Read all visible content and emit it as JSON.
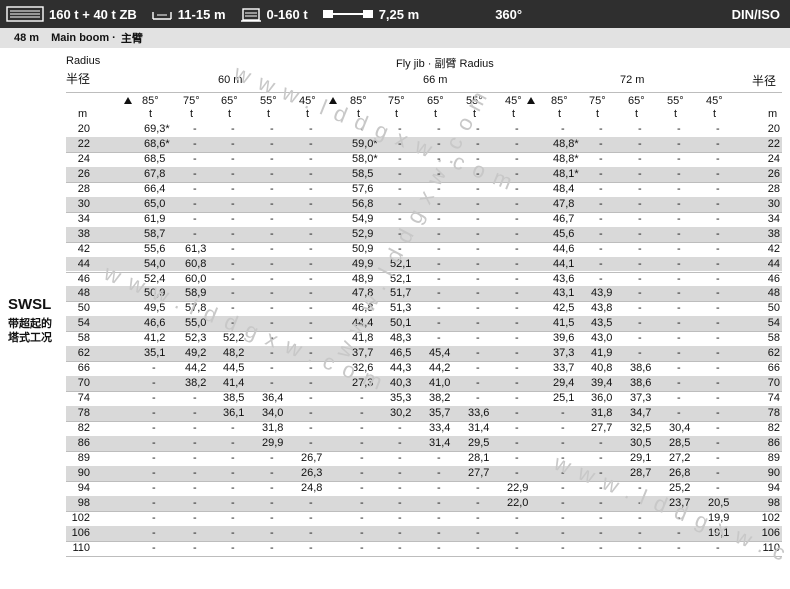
{
  "topbar": {
    "counterweight": "160 t + 40 t ZB",
    "support": "11-15 m",
    "ballast": "0-160 t",
    "track": "7,25 m",
    "slew": "360°",
    "standard": "DIN/ISO"
  },
  "subbar": {
    "boom": "48 m",
    "boom_label": "Main boom ·",
    "boom_label_cn": "主臂"
  },
  "header": {
    "radius_label": "Radius",
    "radius_label_cn": "半径",
    "jib_label": "Fly jib · 副臂 Radius",
    "radius_right_cn": "半径",
    "unit_m": "m",
    "unit_t": "t"
  },
  "side_label": {
    "code": "SWSL",
    "cn_line1": "带超起的",
    "cn_line2": "塔式工况"
  },
  "watermark": "www.lddgxw.com",
  "groups": [
    {
      "jib": "60 m",
      "angles": [
        "85°",
        "75°",
        "65°",
        "55°",
        "45°"
      ]
    },
    {
      "jib": "66 m",
      "angles": [
        "85°",
        "75°",
        "65°",
        "55°",
        "45°"
      ]
    },
    {
      "jib": "72 m",
      "angles": [
        "85°",
        "75°",
        "65°",
        "55°",
        "45°"
      ]
    }
  ],
  "radii": [
    "20",
    "22",
    "24",
    "26",
    "28",
    "30",
    "34",
    "38",
    "42",
    "44",
    "46",
    "48",
    "50",
    "54",
    "58",
    "62",
    "66",
    "70",
    "74",
    "78",
    "82",
    "86",
    "89",
    "90",
    "94",
    "98",
    "102",
    "106",
    "110"
  ],
  "rows": [
    [
      "69,3*",
      "-",
      "-",
      "-",
      "-",
      "-",
      "-",
      "-",
      "-",
      "-",
      "-",
      "-",
      "-",
      "-",
      "-"
    ],
    [
      "68,6*",
      "-",
      "-",
      "-",
      "-",
      "59,0*",
      "-",
      "-",
      "-",
      "-",
      "48,8*",
      "-",
      "-",
      "-",
      "-"
    ],
    [
      "68,5",
      "-",
      "-",
      "-",
      "-",
      "58,0*",
      "-",
      "-",
      "-",
      "-",
      "48,8*",
      "-",
      "-",
      "-",
      "-"
    ],
    [
      "67,8",
      "-",
      "-",
      "-",
      "-",
      "58,5",
      "-",
      "-",
      "-",
      "-",
      "48,1*",
      "-",
      "-",
      "-",
      "-"
    ],
    [
      "66,4",
      "-",
      "-",
      "-",
      "-",
      "57,6",
      "-",
      "-",
      "-",
      "-",
      "48,4",
      "-",
      "-",
      "-",
      "-"
    ],
    [
      "65,0",
      "-",
      "-",
      "-",
      "-",
      "56,8",
      "-",
      "-",
      "-",
      "-",
      "47,8",
      "-",
      "-",
      "-",
      "-"
    ],
    [
      "61,9",
      "-",
      "-",
      "-",
      "-",
      "54,9",
      "-",
      "-",
      "-",
      "-",
      "46,7",
      "-",
      "-",
      "-",
      "-"
    ],
    [
      "58,7",
      "-",
      "-",
      "-",
      "-",
      "52,9",
      "-",
      "-",
      "-",
      "-",
      "45,6",
      "-",
      "-",
      "-",
      "-"
    ],
    [
      "55,6",
      "61,3",
      "-",
      "-",
      "-",
      "50,9",
      "-",
      "-",
      "-",
      "-",
      "44,6",
      "-",
      "-",
      "-",
      "-"
    ],
    [
      "54,0",
      "60,8",
      "-",
      "-",
      "-",
      "49,9",
      "52,1",
      "-",
      "-",
      "-",
      "44,1",
      "-",
      "-",
      "-",
      "-"
    ],
    [
      "52,4",
      "60,0",
      "-",
      "-",
      "-",
      "48,9",
      "52,1",
      "-",
      "-",
      "-",
      "43,6",
      "-",
      "-",
      "-",
      "-"
    ],
    [
      "50,9",
      "58,9",
      "-",
      "-",
      "-",
      "47,8",
      "51,7",
      "-",
      "-",
      "-",
      "43,1",
      "43,9",
      "-",
      "-",
      "-"
    ],
    [
      "49,5",
      "57,8",
      "-",
      "-",
      "-",
      "46,8",
      "51,3",
      "-",
      "-",
      "-",
      "42,5",
      "43,8",
      "-",
      "-",
      "-"
    ],
    [
      "46,6",
      "55,0",
      "-",
      "-",
      "-",
      "44,4",
      "50,1",
      "-",
      "-",
      "-",
      "41,5",
      "43,5",
      "-",
      "-",
      "-"
    ],
    [
      "41,2",
      "52,3",
      "52,2",
      "-",
      "-",
      "41,8",
      "48,3",
      "-",
      "-",
      "-",
      "39,6",
      "43,0",
      "-",
      "-",
      "-"
    ],
    [
      "35,1",
      "49,2",
      "48,2",
      "-",
      "-",
      "37,7",
      "46,5",
      "45,4",
      "-",
      "-",
      "37,3",
      "41,9",
      "-",
      "-",
      "-"
    ],
    [
      "-",
      "44,2",
      "44,5",
      "-",
      "-",
      "32,6",
      "44,3",
      "44,2",
      "-",
      "-",
      "33,7",
      "40,8",
      "38,6",
      "-",
      "-"
    ],
    [
      "-",
      "38,2",
      "41,4",
      "-",
      "-",
      "27,3",
      "40,3",
      "41,0",
      "-",
      "-",
      "29,4",
      "39,4",
      "38,6",
      "-",
      "-"
    ],
    [
      "-",
      "-",
      "38,5",
      "36,4",
      "-",
      "-",
      "35,3",
      "38,2",
      "-",
      "-",
      "25,1",
      "36,0",
      "37,3",
      "-",
      "-"
    ],
    [
      "-",
      "-",
      "36,1",
      "34,0",
      "-",
      "-",
      "30,2",
      "35,7",
      "33,6",
      "-",
      "-",
      "31,8",
      "34,7",
      "-",
      "-"
    ],
    [
      "-",
      "-",
      "-",
      "31,8",
      "-",
      "-",
      "-",
      "33,4",
      "31,4",
      "-",
      "-",
      "27,7",
      "32,5",
      "30,4",
      "-"
    ],
    [
      "-",
      "-",
      "-",
      "29,9",
      "-",
      "-",
      "-",
      "31,4",
      "29,5",
      "-",
      "-",
      "-",
      "30,5",
      "28,5",
      "-"
    ],
    [
      "-",
      "-",
      "-",
      "-",
      "26,7",
      "-",
      "-",
      "-",
      "28,1",
      "-",
      "-",
      "-",
      "29,1",
      "27,2",
      "-"
    ],
    [
      "-",
      "-",
      "-",
      "-",
      "26,3",
      "-",
      "-",
      "-",
      "27,7",
      "-",
      "-",
      "-",
      "28,7",
      "26,8",
      "-"
    ],
    [
      "-",
      "-",
      "-",
      "-",
      "24,8",
      "-",
      "-",
      "-",
      "-",
      "22,9",
      "-",
      "-",
      "-",
      "25,2",
      "-"
    ],
    [
      "-",
      "-",
      "-",
      "-",
      "-",
      "-",
      "-",
      "-",
      "-",
      "22,0",
      "-",
      "-",
      "-",
      "23,7",
      "20,5"
    ],
    [
      "-",
      "-",
      "-",
      "-",
      "-",
      "-",
      "-",
      "-",
      "-",
      "-",
      "-",
      "-",
      "-",
      "-",
      "19,9"
    ],
    [
      "-",
      "-",
      "-",
      "-",
      "-",
      "-",
      "-",
      "-",
      "-",
      "-",
      "-",
      "-",
      "-",
      "-",
      "19,1"
    ],
    [
      "-",
      "-",
      "-",
      "-",
      "-",
      "-",
      "-",
      "-",
      "-",
      "-",
      "-",
      "-",
      "-",
      "-",
      "-"
    ]
  ]
}
